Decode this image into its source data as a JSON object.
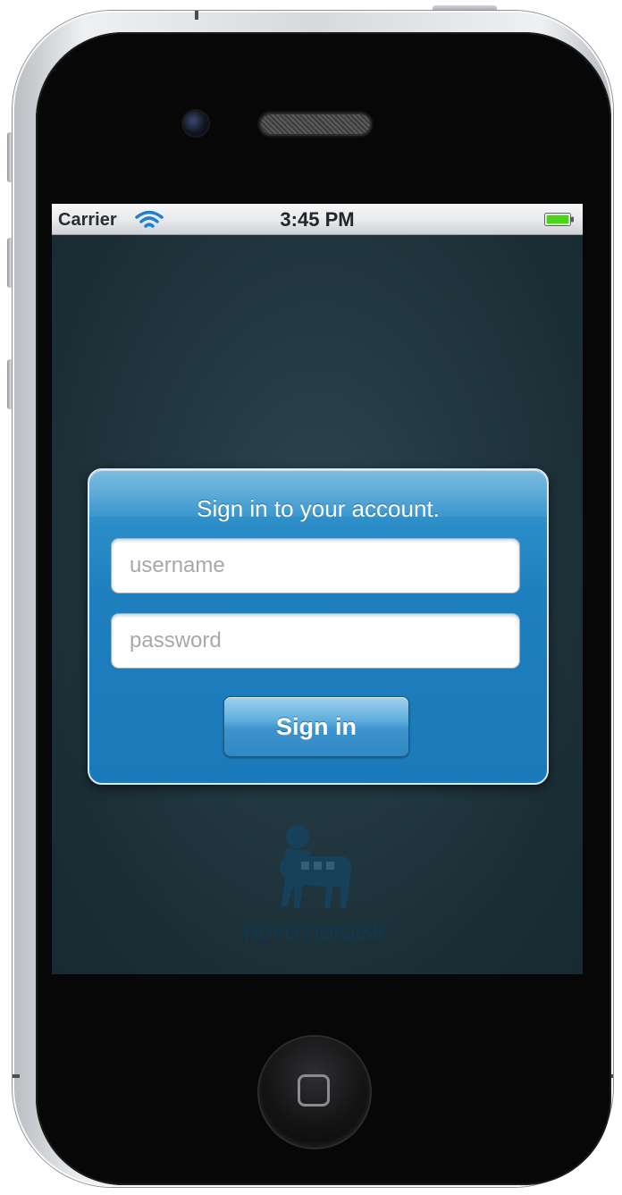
{
  "status_bar": {
    "carrier": "Carrier",
    "time": "3:45 PM",
    "wifi_icon": "wifi-icon",
    "battery_icon": "battery-icon",
    "battery_color": "#4cd41a"
  },
  "login": {
    "title": "Sign in to your account.",
    "username_placeholder": "username",
    "password_placeholder": "password",
    "submit_label": "Sign in",
    "accent_color": "#1e7fbe"
  },
  "brand": {
    "logo_icon": "bull-logo-icon",
    "name": "novo nordisk",
    "registered_mark": "®"
  },
  "device": {
    "home_button_icon": "home-button-icon"
  }
}
